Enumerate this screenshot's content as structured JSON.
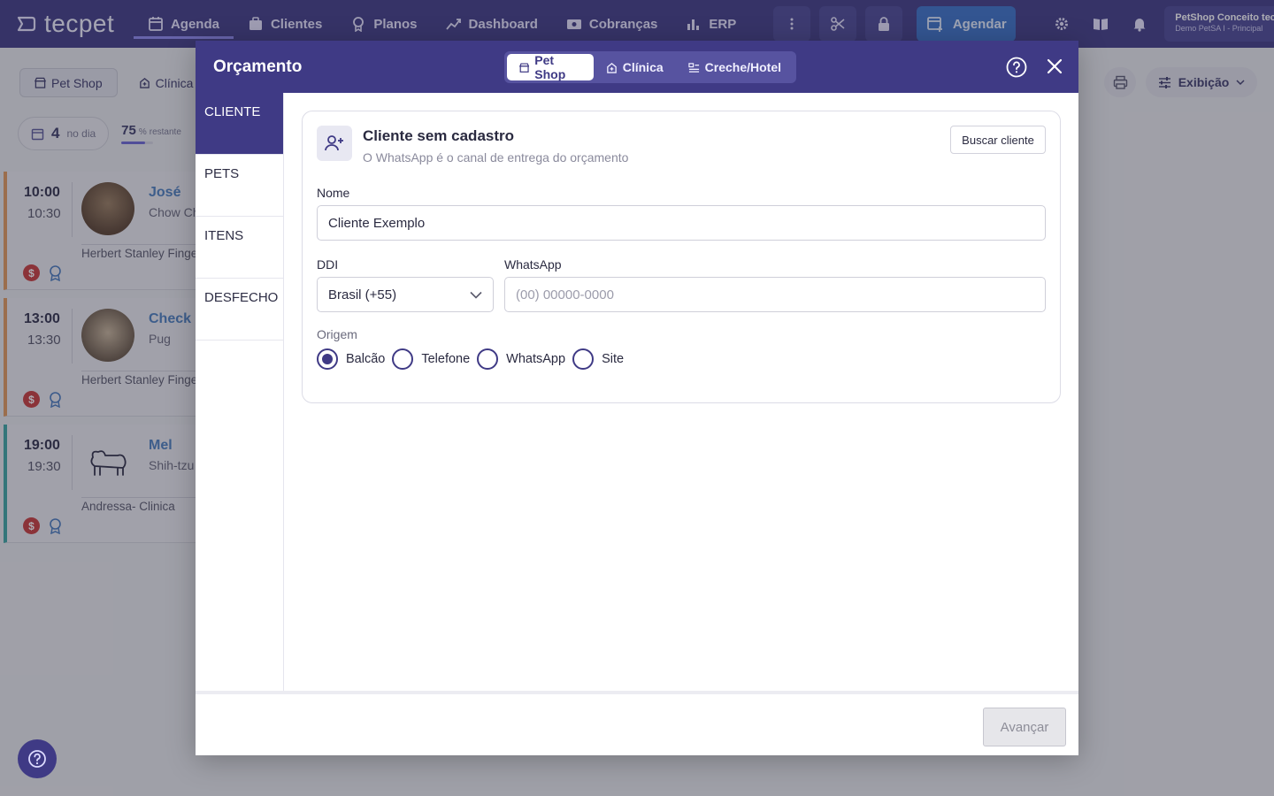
{
  "brand": {
    "name": "tecpet"
  },
  "nav": {
    "items": [
      "Agenda",
      "Clientes",
      "Planos",
      "Dashboard",
      "Cobranças",
      "ERP"
    ],
    "agendar_label": "Agendar",
    "account_name": "PetShop Conceito tecpet",
    "account_sub": "Demo PetSA I - Principal"
  },
  "background": {
    "tabs": [
      "Pet Shop",
      "Clínica"
    ],
    "stats": {
      "count": "4",
      "count_label": "no dia",
      "remaining": "75",
      "remaining_unit": "%",
      "remaining_label": "restante",
      "remaining_fraction": 0.75
    },
    "exibicao_label": "Exibição",
    "appointments": [
      {
        "start": "10:00",
        "end": "10:30",
        "pet": "José",
        "breed": "Chow Chow",
        "professional": "Herbert Stanley Fingers"
      },
      {
        "start": "13:00",
        "end": "13:30",
        "pet": "Check",
        "breed": "Pug",
        "professional": "Herbert Stanley Fingers"
      },
      {
        "start": "19:00",
        "end": "19:30",
        "pet": "Mel",
        "breed": "Shih-tzu",
        "professional": "Andressa- Clinica"
      }
    ]
  },
  "modal": {
    "title": "Orçamento",
    "tabs": [
      "Pet Shop",
      "Clínica",
      "Creche/Hotel"
    ],
    "steps": [
      "CLIENTE",
      "PETS",
      "ITENS",
      "DESFECHO"
    ],
    "card": {
      "title": "Cliente sem cadastro",
      "subtitle": "O WhatsApp é o canal de entrega do orçamento",
      "search_button": "Buscar cliente",
      "name_label": "Nome",
      "name_value": "Cliente Exemplo",
      "ddi_label": "DDI",
      "ddi_value": "Brasil (+55)",
      "whatsapp_label": "WhatsApp",
      "whatsapp_placeholder": "(00) 00000-0000",
      "origin_label": "Origem",
      "origin_options": [
        "Balcão",
        "Telefone",
        "WhatsApp",
        "Site"
      ],
      "origin_selected": "Balcão"
    },
    "next_button": "Avançar"
  },
  "colors": {
    "primary": "#3f3a85",
    "accent_blue": "#3a72c9",
    "badge_red": "#c93a3a"
  }
}
